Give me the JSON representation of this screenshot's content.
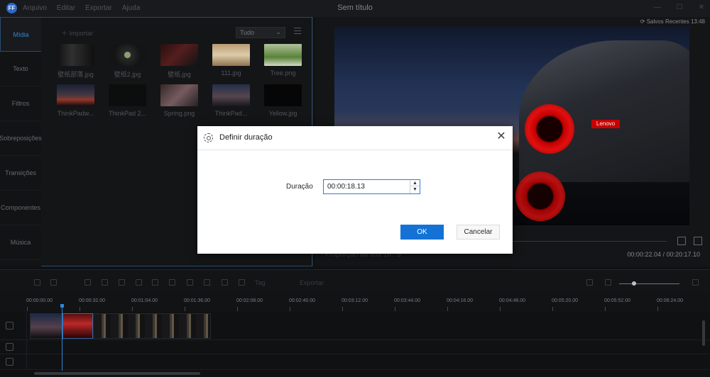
{
  "app": {
    "title": "Sem título",
    "logo": "FF",
    "menu": [
      "Arquivo",
      "Editar",
      "Exportar",
      "Ajuda"
    ]
  },
  "sidebar": {
    "tabs": [
      {
        "label": "Mídia",
        "active": true
      },
      {
        "label": "Texto"
      },
      {
        "label": "Filtros"
      },
      {
        "label": "Sobreposições"
      },
      {
        "label": "Transições"
      },
      {
        "label": "Componentes"
      },
      {
        "label": "Música"
      }
    ]
  },
  "media": {
    "import_label": "Importar",
    "filter_value": "Tudo",
    "items": [
      {
        "name": "壁纸部落.jpg"
      },
      {
        "name": "壁纸2.jpg"
      },
      {
        "name": "壁纸.jpg"
      },
      {
        "name": "111.jpg"
      },
      {
        "name": "Tree.png"
      },
      {
        "name": "ThinkPadw..."
      },
      {
        "name": "ThinkPad 2..."
      },
      {
        "name": "Spring.png"
      },
      {
        "name": "ThinkPad..."
      },
      {
        "name": "Yellow.jpg"
      }
    ]
  },
  "preview": {
    "saved_label": "Salvos Recentes 13:48",
    "aspect_label": "Proporção da tela",
    "aspect_value": "16 : 9",
    "timecode": "00:00:22.04 / 00:20:17.10",
    "watermark": "Lenovo"
  },
  "toolbar": {
    "tag_label": "Tag",
    "export_label": "Exportar"
  },
  "timeline": {
    "ticks": [
      "00:00:00.00",
      "00:00:32.00",
      "00:01:04.00",
      "00:01:36.00",
      "00:02:08.00",
      "00:02:40.00",
      "00:03:12.00",
      "00:03:44.00",
      "00:04:16.00",
      "00:04:48.00",
      "00:05:20.00",
      "00:05:52.00",
      "00:06:24.00"
    ]
  },
  "dialog": {
    "title": "Definir duração",
    "duration_label": "Duração",
    "duration_value": "00:00:18.13",
    "ok_label": "OK",
    "cancel_label": "Cancelar"
  },
  "icons": {
    "close": "close-icon",
    "gear": "gear-icon",
    "spin_up": "chevron-up-icon",
    "spin_down": "chevron-down-icon"
  },
  "colors": {
    "accent": "#1472d6",
    "panel_border": "#2a4f78"
  }
}
